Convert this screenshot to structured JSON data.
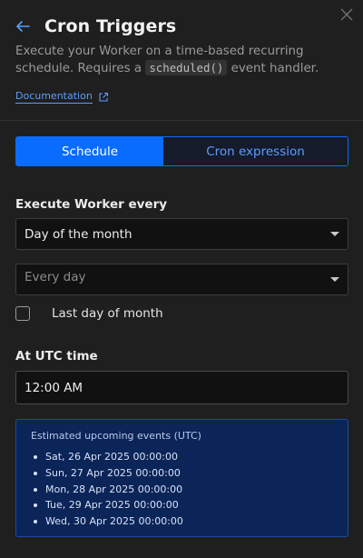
{
  "panel": {
    "title": "Cron Triggers",
    "description_pre": "Execute your Worker on a time-based recurring schedule. Requires a ",
    "description_code": "scheduled()",
    "description_post": " event handler.",
    "doc_link": "Documentation"
  },
  "tabs": [
    {
      "label": "Schedule",
      "active": true
    },
    {
      "label": "Cron expression",
      "active": false
    }
  ],
  "execute_label": "Execute Worker every",
  "frequency_select": {
    "value": "Day of the month"
  },
  "day_select": {
    "placeholder": "Every day"
  },
  "last_day_checkbox": {
    "label": "Last day of month",
    "checked": false
  },
  "time_label": "At UTC time",
  "time_input": {
    "value": "12:00 AM"
  },
  "events": {
    "title": "Estimated upcoming events (UTC)",
    "items": [
      "Sat, 26 Apr 2025 00:00:00",
      "Sun, 27 Apr 2025 00:00:00",
      "Mon, 28 Apr 2025 00:00:00",
      "Tue, 29 Apr 2025 00:00:00",
      "Wed, 30 Apr 2025 00:00:00"
    ]
  },
  "icons": {
    "back": "arrow-left-icon",
    "close": "close-icon",
    "external": "external-link-icon",
    "caret": "chevron-down-icon"
  },
  "colors": {
    "accent": "#0a6cff",
    "link": "#5b9dff",
    "events_bg": "#0b2559",
    "panel_bg": "#1f1f1f"
  }
}
